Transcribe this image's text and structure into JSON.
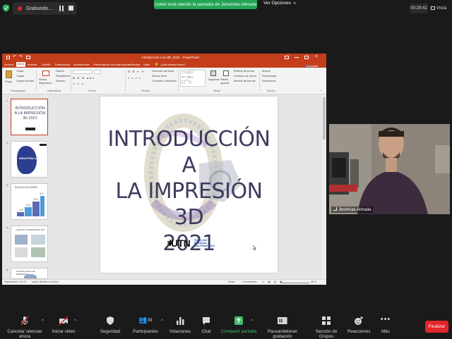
{
  "top_bar": {
    "recording_label": "Grabando...",
    "share_banner": "Usted está viendo la pantalla de Jeremías Almada",
    "view_options": "Ver Opciones",
    "timer": "00:29:41",
    "view_label": "Vista"
  },
  "ppt": {
    "window_title": "Introducción a la I3D_2021 - PowerPoint",
    "tabs": [
      "Archivo",
      "Inicio",
      "Insertar",
      "Diseño",
      "Transiciones",
      "Animaciones",
      "Presentación con diapositivas",
      "Revisar",
      "Vista"
    ],
    "tell_me": "¿Qué desea hacer?",
    "share_button": "Compartir",
    "ribbon": {
      "paste": "Pegar",
      "cut": "Cortar",
      "copy": "Copiar",
      "format_painter": "Copiar formato",
      "new_slide": "Nueva diapositiva",
      "layout": "Diseño",
      "reset": "Restablecer",
      "section": "Sección",
      "groups": [
        "Portapapeles",
        "Diapositivas",
        "Fuente",
        "Párrafo",
        "Dibujo",
        "Edición"
      ],
      "text_direction": "Dirección del texto",
      "align_text": "Alinear texto",
      "smartart": "Convertir a SmartArt",
      "arrange": "Organizar",
      "quick_styles": "Estilos rápidos",
      "shape_fill": "Relleno de forma",
      "shape_outline": "Contorno de forma",
      "shape_effects": "Efectos de formas",
      "find": "Buscar",
      "replace": "Reemplazar",
      "select": "Seleccionar"
    },
    "slide_numbers": [
      "1",
      "2",
      "3",
      "4",
      "5"
    ],
    "thumbs": {
      "t1_title": "INTRODUCCIÓN A LA IMPRESIÓN 3D 2021",
      "t2_title": "INDUSTRIA 4.0",
      "t3_title": "NIVELES DE DISEÑO",
      "t4_title": "¿QUÉ ES LA IMPRESIÓN 3D?",
      "t5_title": "TECNOLOGÍAS DE IMPRESIÓN"
    },
    "slide": {
      "title_line1": "INTRODUCCIÓN A",
      "title_line2": "LA IMPRESIÓN 3D",
      "title_line3": "2021",
      "logo_text": "UTN",
      "logo_sub1": "FACULTAD",
      "logo_sub2": "REGIONAL",
      "logo_sub3": "SAN FRANCISCO"
    },
    "status": {
      "slide_count": "Diapositiva 1 de 33",
      "language": "Inglés (Estados Unidos)",
      "notes": "Notas",
      "comments": "Comentarios",
      "zoom": "46 %"
    }
  },
  "video": {
    "participant_name": "Jeremías Almada"
  },
  "toolbar": {
    "mute": "Cancelar silenciar ahora",
    "video": "Iniciar video",
    "security": "Seguridad",
    "participants": "Participantes",
    "participants_count": "39",
    "polls": "Votaciones",
    "chat": "Chat",
    "share": "Compartir pantalla",
    "pause_recording": "Pausar/detener grabación",
    "breakout": "Sección de Grupos",
    "reactions": "Reacciones",
    "more": "Más",
    "end": "Finalizar"
  },
  "colors": {
    "ppt_accent": "#c43e1c",
    "share_banner": "#23a455",
    "end_button": "#e0262c",
    "slide_title": "#3d3b5e"
  }
}
